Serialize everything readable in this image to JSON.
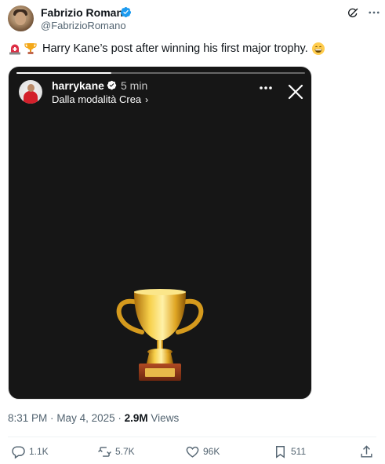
{
  "author": {
    "display_name": "Fabrizio Romano",
    "handle": "@FabrizioRomano",
    "verified": true
  },
  "tweet": {
    "emojis": [
      "rotating-light-emoji",
      "trophy-emoji",
      "grinning-face-emoji"
    ],
    "text": "Harry Kane’s post after winning his first major trophy."
  },
  "story": {
    "username": "harrykane",
    "verified": true,
    "time_ago": "5 min",
    "source_label": "Dalla modalità Crea",
    "source_chevron": "›",
    "progress": 0.33
  },
  "meta": {
    "time": "8:31 PM",
    "separator": "·",
    "date": "May 4, 2025",
    "views_count": "2.9M",
    "views_label": "Views"
  },
  "actions": {
    "replies": "1.1K",
    "reposts": "5.7K",
    "likes": "96K",
    "bookmarks": "511"
  },
  "colors": {
    "text_primary": "#0f1419",
    "text_secondary": "#536471",
    "verified_blue": "#1d9bf0",
    "story_background": "#161616"
  }
}
